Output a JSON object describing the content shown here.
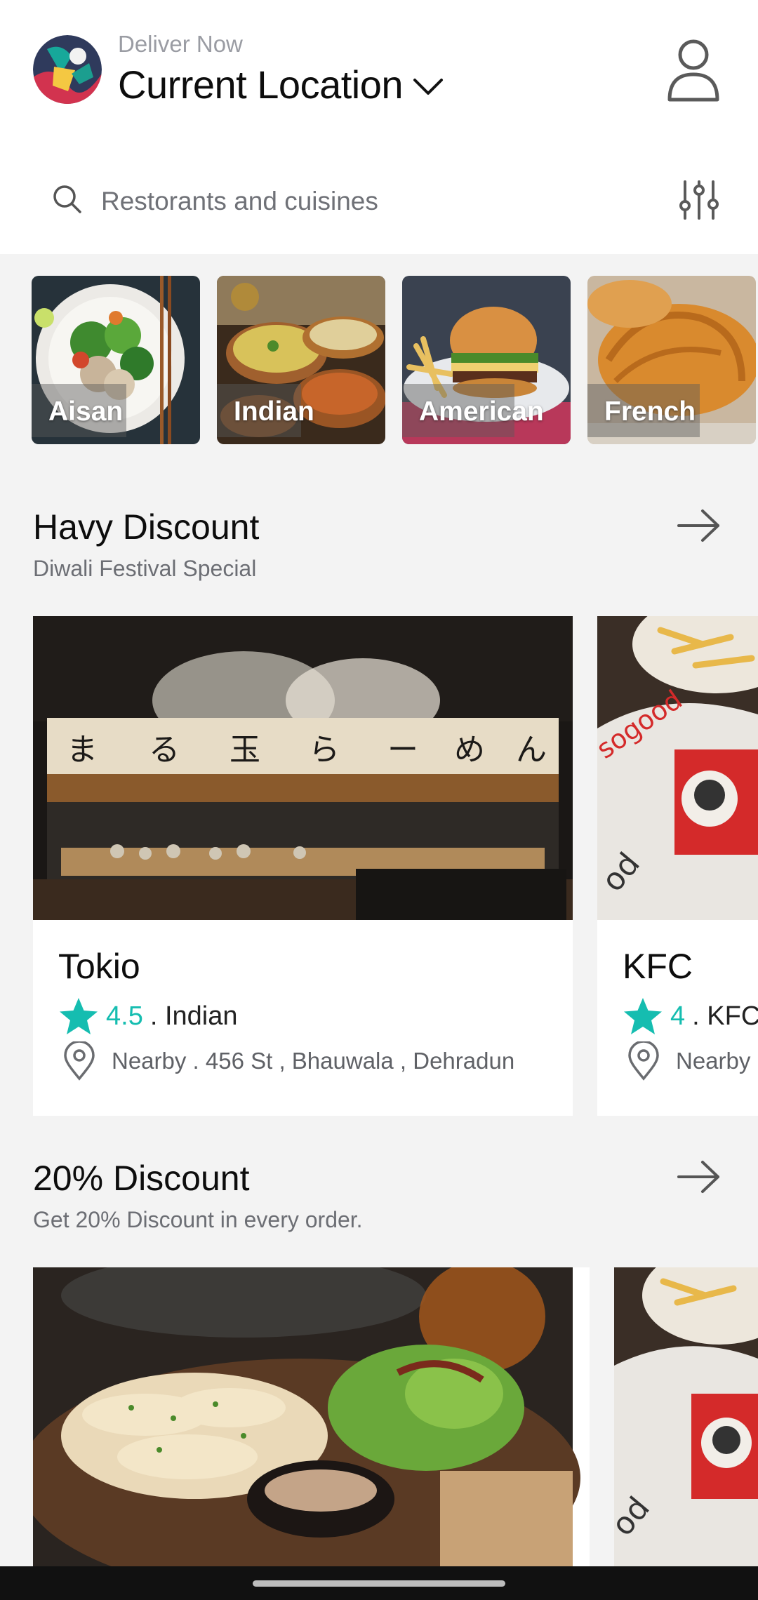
{
  "header": {
    "deliver_label": "Deliver Now",
    "location": "Current Location"
  },
  "search": {
    "placeholder": "Restorants and cuisines"
  },
  "categories": [
    {
      "label": "Aisan"
    },
    {
      "label": "Indian"
    },
    {
      "label": "American"
    },
    {
      "label": "French"
    }
  ],
  "sections": [
    {
      "title": "Havy Discount",
      "subtitle": "Diwali Festival Special",
      "restaurants": [
        {
          "name": "Tokio",
          "rating": "4.5",
          "cuisine": ". Indian",
          "address": "Nearby . 456 St , Bhauwala , Dehradun"
        },
        {
          "name": "KFC",
          "rating": "4",
          "cuisine": ". KFC",
          "address": "Nearby"
        }
      ]
    },
    {
      "title": "20% Discount",
      "subtitle": "Get 20% Discount in every order."
    }
  ],
  "colors": {
    "accent": "#15bdb0",
    "background": "#f3f3f3",
    "card": "#ffffff",
    "text_primary": "#0d0d0d",
    "text_secondary": "#6c6e74"
  },
  "icons": [
    "avatar-logo",
    "chevron-down-icon",
    "profile-icon",
    "search-icon",
    "filter-icon",
    "arrow-right-icon",
    "star-icon",
    "location-pin-icon"
  ]
}
